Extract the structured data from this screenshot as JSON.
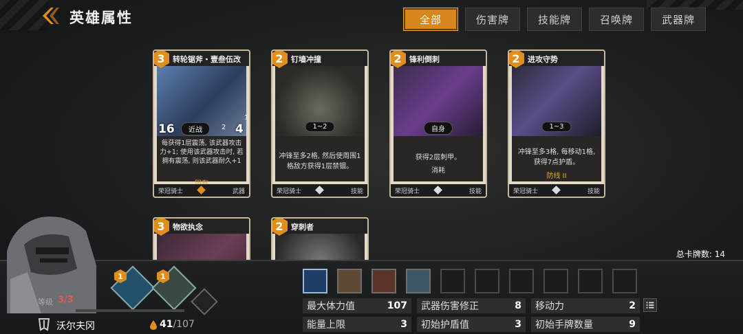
{
  "header": {
    "title": "英雄属性",
    "back_icon": "back-arrow-icon"
  },
  "tabs": [
    {
      "label": "全部",
      "active": true
    },
    {
      "label": "伤害牌",
      "active": false
    },
    {
      "label": "技能牌",
      "active": false
    },
    {
      "label": "召唤牌",
      "active": false
    },
    {
      "label": "武器牌",
      "active": false
    }
  ],
  "cards": [
    {
      "cost": "3",
      "name": "转轮锯斧・壹叁伍改",
      "range": "近战",
      "atk": "16",
      "durability": "4",
      "sub_cost": "2",
      "sub_num": "1",
      "desc": "每获得1层震荡, 该武器攻击力+1; 使用该武器攻击时, 若拥有震荡, 则该武器耐久+1",
      "keyword": "固有",
      "hero": "荣冠骑士",
      "type": "武器"
    },
    {
      "cost": "2",
      "name": "钉墙冲撞",
      "range": "1~2",
      "desc": "冲锋至多2格, 然后使周围1格敌方获得1层禁锢。",
      "hero": "荣冠骑士",
      "type": "技能"
    },
    {
      "cost": "2",
      "name": "锋利倒刺",
      "range": "自身",
      "desc": "获得2层刺甲。",
      "keyword": "消耗",
      "hero": "荣冠骑士",
      "type": "技能"
    },
    {
      "cost": "2",
      "name": "进攻守势",
      "range": "1~3",
      "desc": "冲锋至多3格, 每移动1格, 获得7点护盾。",
      "keyword": "防线 II",
      "hero": "荣冠骑士",
      "type": "技能"
    },
    {
      "cost": "3",
      "name": "物欲执念"
    },
    {
      "cost": "2",
      "name": "穿刺者"
    }
  ],
  "total_cards": {
    "label": "总卡牌数:",
    "value": "14"
  },
  "hero": {
    "level_label": "等级",
    "level": "3/3",
    "name": "沃尔夫冈",
    "hp": "41",
    "hp_max": "/107"
  },
  "equipment": [
    {
      "badge": "1"
    },
    {
      "badge": "1"
    }
  ],
  "stats": [
    {
      "label": "最大体力值",
      "value": "107"
    },
    {
      "label": "武器伤害修正",
      "value": "8"
    },
    {
      "label": "移动力",
      "value": "2"
    },
    {
      "label": "能量上限",
      "value": "3"
    },
    {
      "label": "初始护盾值",
      "value": "3"
    },
    {
      "label": "初始手牌数量",
      "value": "9"
    }
  ],
  "colors": {
    "accent": "#d9861b",
    "highlight": "#4fb3ff",
    "level": "#e85a4a"
  }
}
